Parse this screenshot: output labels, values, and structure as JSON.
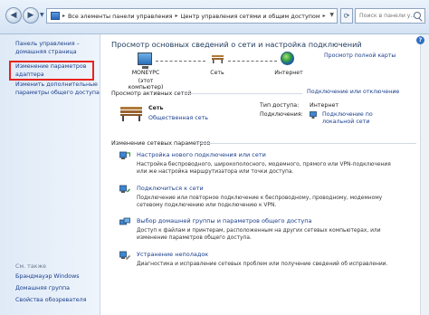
{
  "address": {
    "breadcrumb": [
      "Все элементы панели управления",
      "Центр управления сетями и общим доступом"
    ],
    "search_placeholder": "Поиск в панели у..."
  },
  "sidebar": {
    "home": "Панель управления –",
    "home2": "домашняя страница",
    "adapter1": "Изменение параметров",
    "adapter2": "адаптера",
    "sharing1": "Изменить дополнительные",
    "sharing2": "параметры общего доступа",
    "see_also": "См. также",
    "links": [
      "Брандмауэр Windows",
      "Домашняя группа",
      "Свойства обозревателя"
    ]
  },
  "main": {
    "title": "Просмотр основных сведений о сети и настройка подключений",
    "full_map": "Просмотр полной карты",
    "nodes": {
      "computer": "MONEYPC",
      "computer_sub": "(этот компьютер)",
      "network": "Сеть",
      "internet": "Интернет"
    },
    "active_header": "Просмотр активных сетей",
    "connect_disconnect": "Подключение или отключение",
    "active_network": {
      "name": "Сеть",
      "type": "Общественная сеть",
      "access_label": "Тип доступа:",
      "access_value": "Интернет",
      "conn_label": "Подключения:",
      "conn_value1": "Подключение по",
      "conn_value2": "локальной сети"
    },
    "change_header": "Изменение сетевых параметров",
    "tasks": [
      {
        "title": "Настройка нового подключения или сети",
        "desc1": "Настройка беспроводного, широкополосного, модемного, прямого или VPN-подключения",
        "desc2": "или же настройка маршрутизатора или точки доступа."
      },
      {
        "title": "Подключиться к сети",
        "desc1": "Подключение или повторное подключение к беспроводному, проводному, модемному",
        "desc2": "сетевому подключению или подключению к VPN."
      },
      {
        "title": "Выбор домашней группы и параметров общего доступа",
        "desc1": "Доступ к файлам и принтерам, расположенным на других сетевых компьютерах, или",
        "desc2": "изменение параметров общего доступа."
      },
      {
        "title": "Устранение неполадок",
        "desc1": "Диагностика и исправление сетевых проблем или получение сведений об исправлении.",
        "desc2": ""
      }
    ]
  },
  "colors": {
    "link": "#1a3e8c",
    "highlight": "#e8231e",
    "title": "#1e395b"
  }
}
